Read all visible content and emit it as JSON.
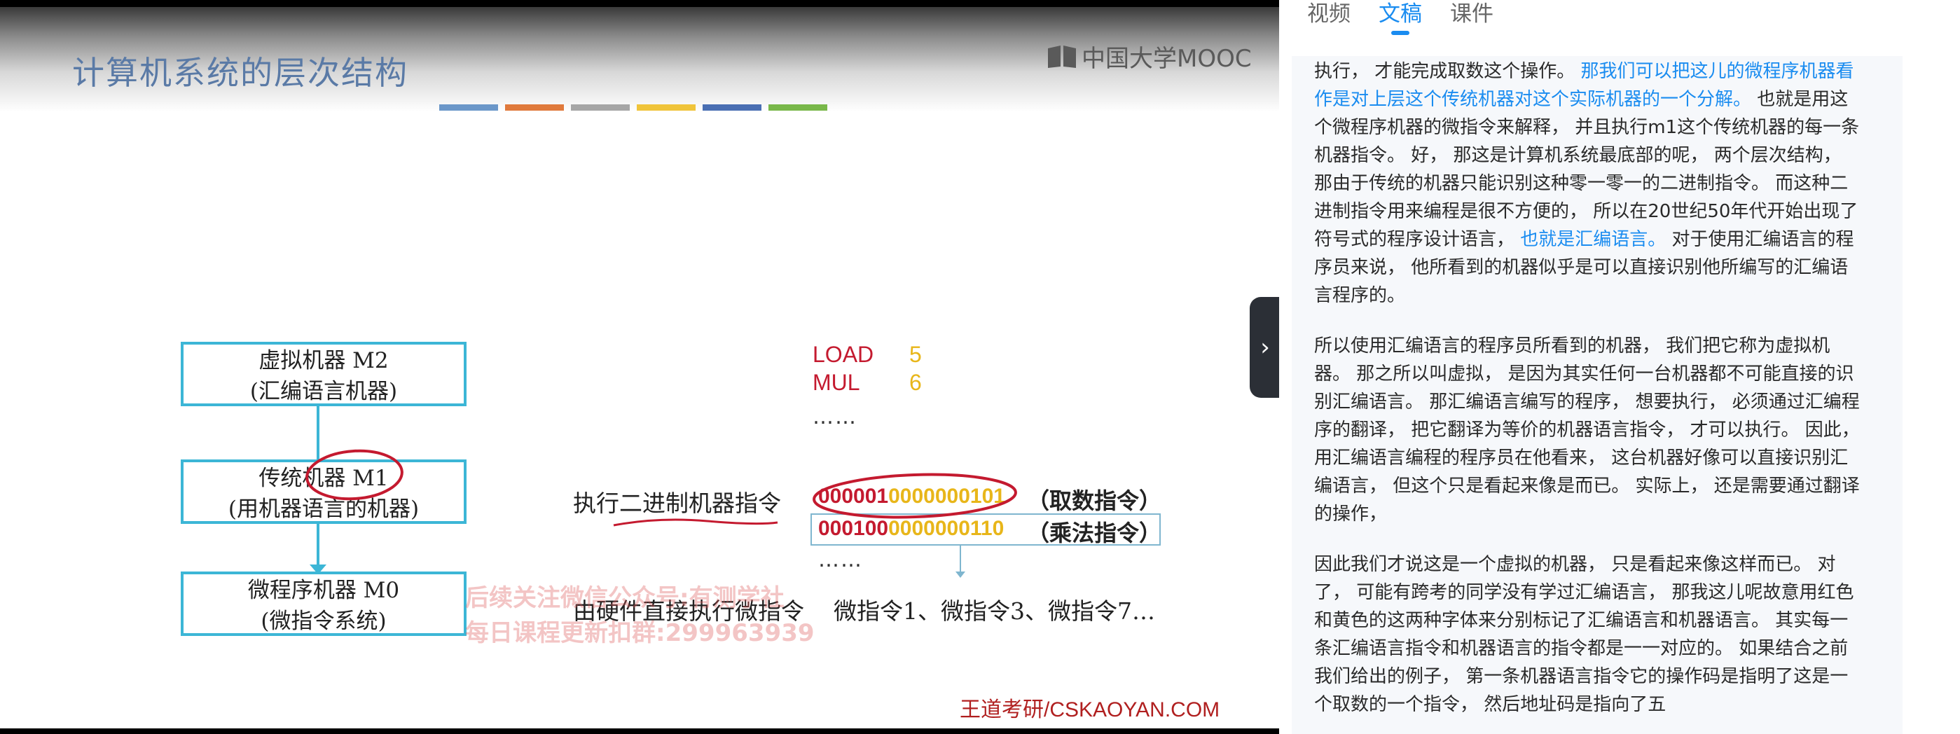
{
  "video": {
    "slide_title": "计算机系统的层次结构",
    "title_bar_colors": [
      "#6b97c9",
      "#e07a3c",
      "#a6a6a6",
      "#f0c43a",
      "#4a6fb3",
      "#79b84a"
    ],
    "logo_text": "中国大学MOOC",
    "boxes": [
      {
        "line1": "虚拟机器 M2",
        "line2": "(汇编语言机器)"
      },
      {
        "line1": "传统机器 M1",
        "line2": "(用机器语言的机器)"
      },
      {
        "line1": "微程序机器 M0",
        "line2": "(微指令系统)"
      }
    ],
    "asm": [
      {
        "op": "LOAD",
        "arg": "5"
      },
      {
        "op": "MUL",
        "arg": "6"
      }
    ],
    "dots": "……",
    "exec_binary_label": "执行二进制机器指令",
    "binary_rows": [
      {
        "opcode": "000001",
        "addr": "0000000101",
        "tag": "（取数指令）"
      },
      {
        "opcode": "000100",
        "addr": "0000000110",
        "tag": "（乘法指令）"
      }
    ],
    "hw_label": "由硬件直接执行微指令",
    "micro_instr": "微指令1、微指令3、微指令7…",
    "watermark_line1": "后续关注微信公众号:有测学社",
    "watermark_line2": "每日课程更新扣群:299963939",
    "credit": "王道考研/CSKAOYAN.COM"
  },
  "panel": {
    "tabs": [
      {
        "label": "视频",
        "active": false
      },
      {
        "label": "文稿",
        "active": true
      },
      {
        "label": "课件",
        "active": false
      }
    ],
    "toggle_icon": "›",
    "para1": {
      "t1": "执行， 才能完成取数这个操作。 ",
      "h1": "那我们可以把这儿的微程序机器看作是对上层这个传统机器对这个实际机器的一个分解。",
      "t2": " 也就是用这个微程序机器的微指令来解释， 并且执行m1这个传统机器的每一条机器指令。 好， 那这是计算机系统最底部的呢， 两个层次结构， 那由于传统的机器只能识别这种零一零一的二进制指令。 而这种二进制指令用来编程是很不方便的， 所以在20世纪50年代开始出现了符号式的程序设计语言， ",
      "h2": "也就是汇编语言。",
      "t3": " 对于使用汇编语言的程序员来说， 他所看到的机器似乎是可以直接识别他所编写的汇编语言程序的。"
    },
    "para2": "所以使用汇编语言的程序员所看到的机器， 我们把它称为虚拟机器。 那之所以叫虚拟， 是因为其实任何一台机器都不可能直接的识别汇编语言。 那汇编语言编写的程序， 想要执行， 必须通过汇编程序的翻译， 把它翻译为等价的机器语言指令， 才可以执行。 因此， 用汇编语言编程的程序员在他看来， 这台机器好像可以直接识别汇编语言， 但这个只是看起来像是而已。 实际上， 还是需要通过翻译的操作，",
    "para3": "因此我们才说这是一个虚拟的机器， 只是看起来像这样而已。 对了， 可能有跨考的同学没有学过汇编语言， 那我这儿呢故意用红色和黄色的这两种字体来分别标记了汇编语言和机器语言。 其实每一条汇编语言指令和机器语言的指令都是一一对应的。 如果结合之前我们给出的例子， 第一条机器语言指令它的操作码是指明了这是一个取数的一个指令， 然后地址码是指向了五"
  }
}
